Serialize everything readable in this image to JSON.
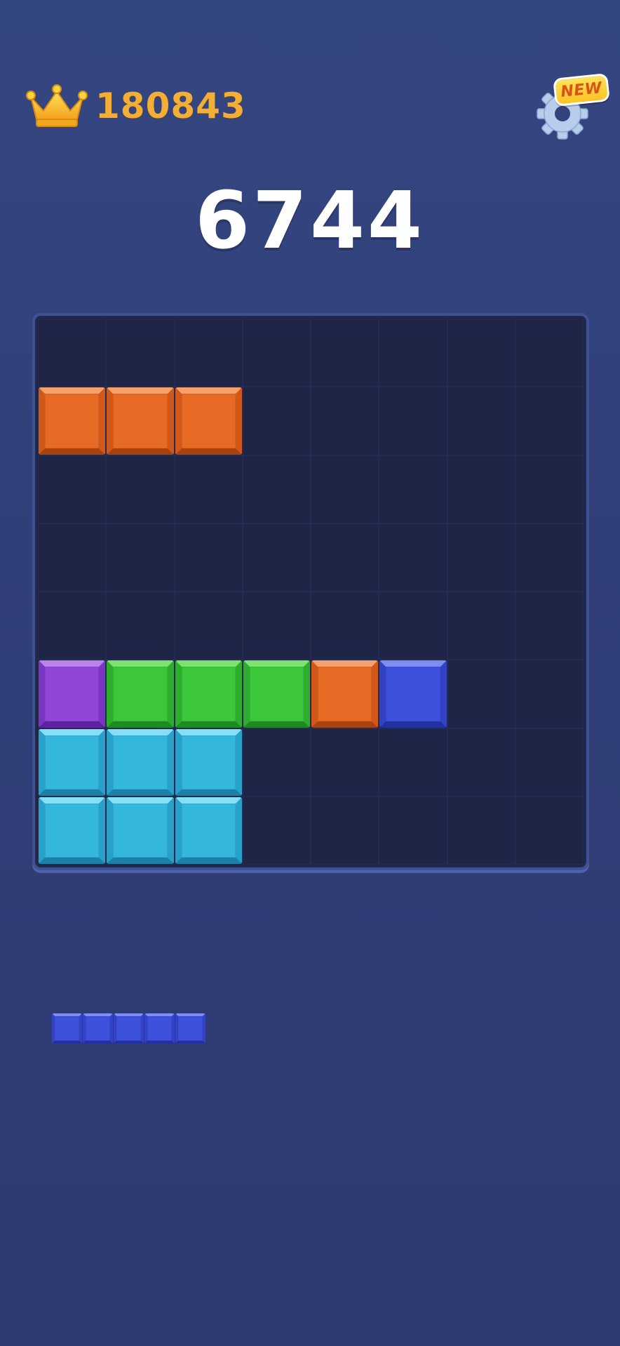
{
  "header": {
    "best_score": "180843",
    "crown_icon": "crown-icon",
    "settings_icon": "gear-icon",
    "new_badge_label": "NEW"
  },
  "score": {
    "current": "6744"
  },
  "colors": {
    "background": "#313f79",
    "board": "#1f2546",
    "board_border": "#3e5195",
    "best_score_text": "#f3ae36",
    "orange": "#e76a25",
    "green": "#3cc63a",
    "purple": "#9146d8",
    "blue": "#3e51dc",
    "cyan": "#34b7dd",
    "badge": "#ffd23c"
  },
  "board": {
    "rows": 8,
    "cols": 8,
    "cells": [
      {
        "row": 1,
        "col": 0,
        "color": "orange"
      },
      {
        "row": 1,
        "col": 1,
        "color": "orange"
      },
      {
        "row": 1,
        "col": 2,
        "color": "orange"
      },
      {
        "row": 5,
        "col": 0,
        "color": "purple"
      },
      {
        "row": 5,
        "col": 1,
        "color": "green"
      },
      {
        "row": 5,
        "col": 2,
        "color": "green"
      },
      {
        "row": 5,
        "col": 3,
        "color": "green"
      },
      {
        "row": 5,
        "col": 4,
        "color": "orange"
      },
      {
        "row": 5,
        "col": 5,
        "color": "blue"
      },
      {
        "row": 6,
        "col": 0,
        "color": "cyan"
      },
      {
        "row": 6,
        "col": 1,
        "color": "cyan"
      },
      {
        "row": 6,
        "col": 2,
        "color": "cyan"
      },
      {
        "row": 7,
        "col": 0,
        "color": "cyan"
      },
      {
        "row": 7,
        "col": 1,
        "color": "cyan"
      },
      {
        "row": 7,
        "col": 2,
        "color": "cyan"
      }
    ]
  },
  "tray": {
    "pieces": [
      {
        "name": "tray-piece-1x5",
        "color": "blue",
        "cells": [
          [
            0,
            0
          ],
          [
            0,
            1
          ],
          [
            0,
            2
          ],
          [
            0,
            3
          ],
          [
            0,
            4
          ]
        ]
      }
    ]
  }
}
